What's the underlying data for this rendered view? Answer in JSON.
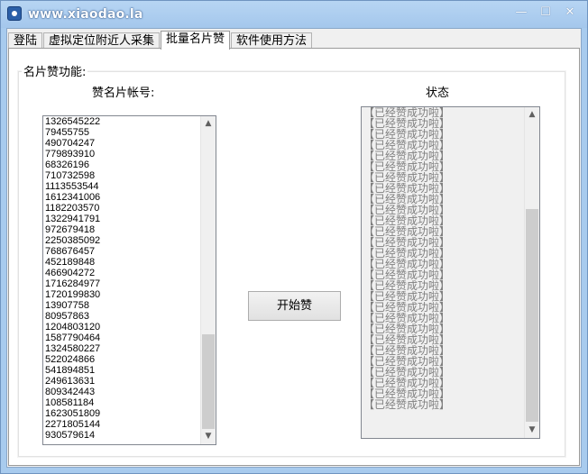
{
  "window": {
    "title": "www.xiaodao.la",
    "minimize_glyph": "—",
    "maximize_glyph": "☐",
    "close_glyph": "✕"
  },
  "tabs": [
    {
      "label": "登陆",
      "active": false
    },
    {
      "label": "虚拟定位附近人采集",
      "active": false
    },
    {
      "label": "批量名片赞",
      "active": true
    },
    {
      "label": "软件使用方法",
      "active": false
    }
  ],
  "panel": {
    "group_label": "名片赞功能:",
    "accounts_label": "赞名片帐号:",
    "status_label": "状态",
    "start_button": "开始赞",
    "accounts": [
      "1326545222",
      "79455755",
      "490704247",
      "779893910",
      "68326196",
      "710732598",
      "1113553544",
      "1612341006",
      "1182203570",
      "1322941791",
      "972679418",
      "2250385092",
      "768676457",
      "452189848",
      "466904272",
      "1716284977",
      "1720199830",
      "13907758",
      "80957863",
      "1204803120",
      "1587790464",
      "1324580227",
      "522024866",
      "541894851",
      "249613631",
      "809342443",
      "108581184",
      "1623051809",
      "2271805144",
      "930579614"
    ],
    "status_items": [
      "【已经赞成功啦】",
      "【已经赞成功啦】",
      "【已经赞成功啦】",
      "【已经赞成功啦】",
      "【已经赞成功啦】",
      "【已经赞成功啦】",
      "【已经赞成功啦】",
      "【已经赞成功啦】",
      "【已经赞成功啦】",
      "【已经赞成功啦】",
      "【已经赞成功啦】",
      "【已经赞成功啦】",
      "【已经赞成功啦】",
      "【已经赞成功啦】",
      "【已经赞成功啦】",
      "【已经赞成功啦】",
      "【已经赞成功啦】",
      "【已经赞成功啦】",
      "【已经赞成功啦】",
      "【已经赞成功啦】",
      "【已经赞成功啦】",
      "【已经赞成功啦】",
      "【已经赞成功啦】",
      "【已经赞成功啦】",
      "【已经赞成功啦】",
      "【已经赞成功啦】",
      "【已经赞成功啦】",
      "【已经赞成功啦】"
    ],
    "scroll_up_glyph": "▲",
    "scroll_down_glyph": "▼"
  },
  "icons": {
    "app": "app-logo-icon",
    "scroll_up": "chevron-up-icon",
    "scroll_down": "chevron-down-icon"
  },
  "colors": {
    "title_bar": "#a8cbee",
    "status_text": "#7f7f7f"
  }
}
